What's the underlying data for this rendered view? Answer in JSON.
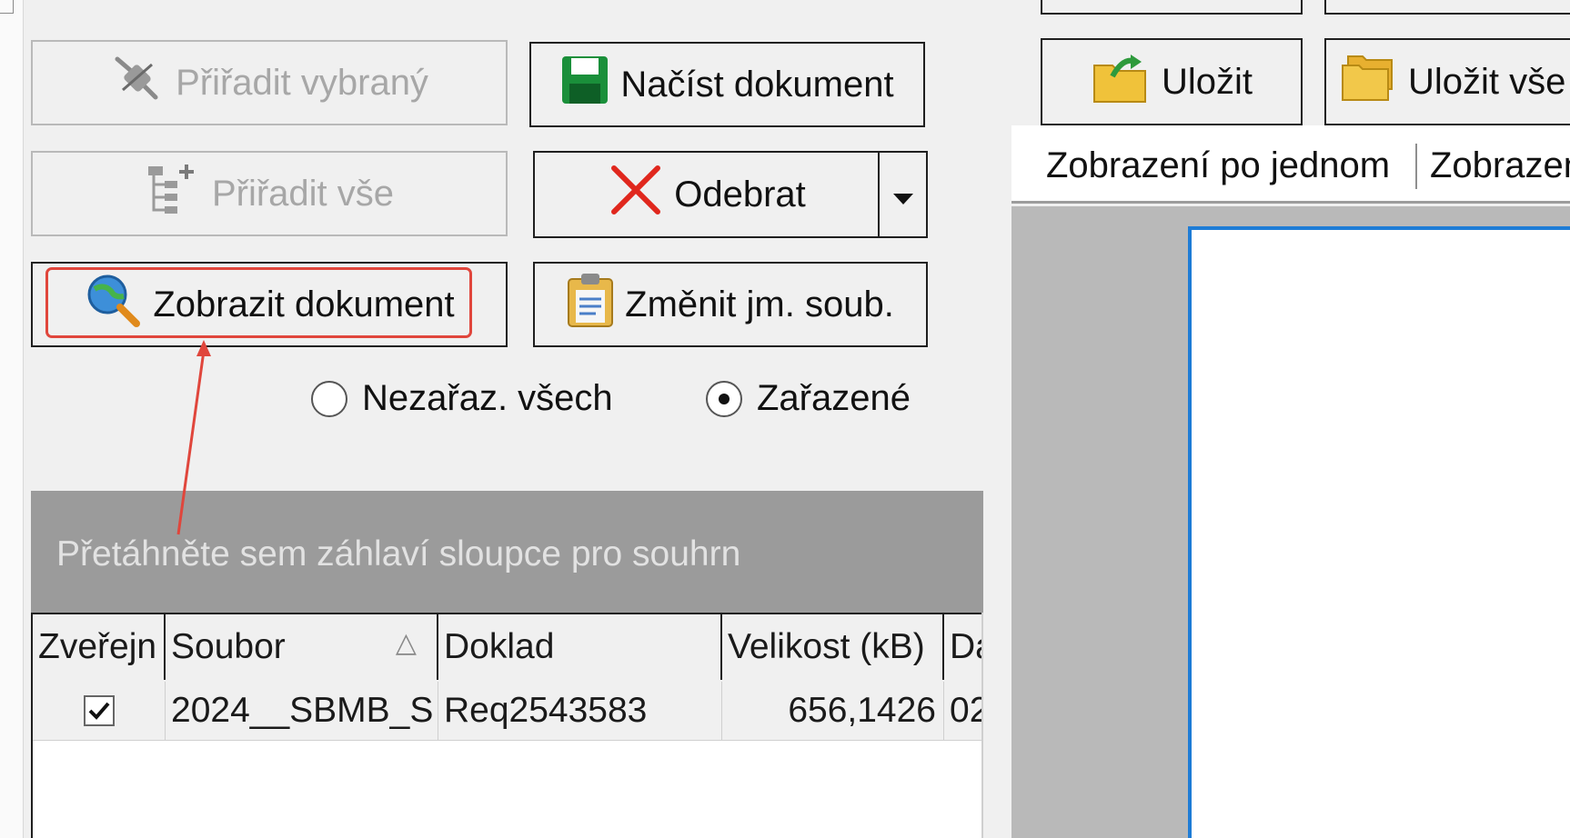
{
  "buttons": {
    "assign_selected": "Přiřadit vybraný",
    "load_document": "Načíst dokument",
    "assign_all": "Přiřadit vše",
    "remove": "Odebrat",
    "show_document": "Zobrazit dokument",
    "rename_file": "Změnit jm. soub.",
    "save": "Uložit",
    "save_all": "Uložit vše"
  },
  "filter": {
    "unassigned_all": "Nezařaz. všech",
    "assigned": "Zařazené",
    "selected": "assigned"
  },
  "grid": {
    "group_hint": "Přetáhněte sem záhlaví sloupce pro souhrn",
    "columns": [
      "Zveřejn",
      "Soubor",
      "Doklad",
      "Velikost (kB)",
      "Da"
    ],
    "sort_indicator": "△",
    "rows": [
      {
        "published": true,
        "file": "2024__SBMB_S",
        "document": "Req2543583",
        "size": "656,1426",
        "date": "02"
      }
    ]
  },
  "viewer": {
    "tabs": [
      "Zobrazení po jednom",
      "Zobrazení"
    ]
  },
  "icons": {
    "assign_selected": "unplugged-connector-icon",
    "load_document": "floppy-disk-icon",
    "assign_all": "tree-add-icon",
    "remove": "red-x-icon",
    "remove_dropdown": "chevron-down-icon",
    "show_document": "magnifier-globe-icon",
    "rename_file": "clipboard-icon",
    "save": "folder-arrow-icon",
    "save_all": "folders-icon"
  },
  "colors": {
    "annotation": "#e0463c",
    "viewer_accent": "#1e7cd6",
    "remove_icon": "#e0271d",
    "floppy_icon": "#1a8f3a"
  }
}
